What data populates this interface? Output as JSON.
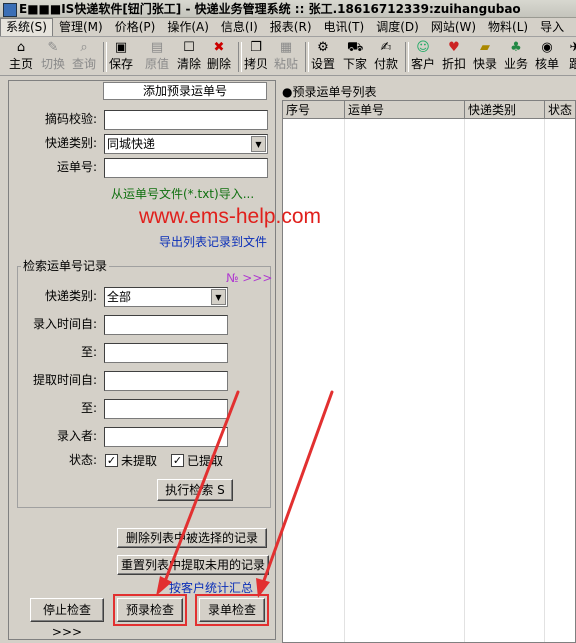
{
  "window": {
    "title": "E■■■IS快递软件[钮门张工] - 快递业务管理系统 :: 张工.18616712339:zuihangubao"
  },
  "menubar": [
    "系统(S)",
    "管理(M)",
    "价格(P)",
    "操作(A)",
    "信息(I)",
    "报表(R)",
    "电讯(T)",
    "调度(D)",
    "网站(W)",
    "物料(L)",
    "导入"
  ],
  "toolbar": [
    "主页",
    "切换",
    "查询",
    "保存",
    "原值",
    "清除",
    "删除",
    "拷贝",
    "粘贴",
    "设置",
    "下家",
    "付款",
    "客户",
    "折扣",
    "快录",
    "业务",
    "核单",
    "跟"
  ],
  "left": {
    "add_link": "添加预录运单号",
    "checksum_label": "摘码校验:",
    "type_label": "快递类别:",
    "type_value": "同城快递",
    "waybill_label": "运单号:",
    "import_link": "从运单号文件(*.txt)导入...",
    "export_link": "导出列表记录到文件",
    "search_group": "检索运单号记录",
    "no_link": "№ >>>",
    "s_type_label": "快递类别:",
    "s_type_value": "全部",
    "s_from_label": "录入时间自:",
    "s_to_label": "至:",
    "s_fetch_from_label": "提取时间自:",
    "s_fetch_to_label": "至:",
    "s_user_label": "录入者:",
    "s_status_label": "状态:",
    "s_unfetched": "未提取",
    "s_fetched": "已提取",
    "execute_btn": "执行检索 S",
    "delete_selected_btn": "删除列表中被选择的记录",
    "reset_unused_btn": "重置列表中提取未用的记录",
    "customer_summary_link": "按客户统计汇总",
    "stop_btn": "停止检查>>>",
    "prerecord_btn": "预录检查",
    "record_btn": "录单检查"
  },
  "right": {
    "list_title": "●预录运单号列表",
    "columns": [
      "序号",
      "运单号",
      "快递类别",
      "状态"
    ]
  },
  "watermark": "www.ems-help.com",
  "colors": {
    "annotation_red": "#e23030"
  }
}
